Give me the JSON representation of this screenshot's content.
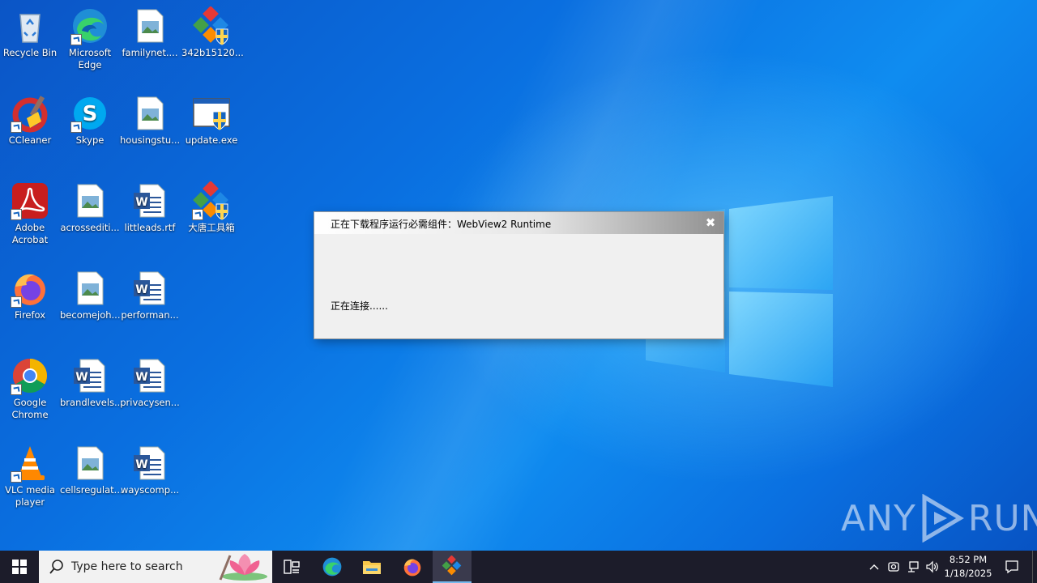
{
  "desktop": {
    "icons": [
      {
        "label": "Recycle Bin",
        "icon": "recycle-bin-icon"
      },
      {
        "label": "Microsoft Edge",
        "icon": "edge-icon"
      },
      {
        "label": "familynet....",
        "icon": "image-file-icon"
      },
      {
        "label": "342b15120...",
        "icon": "app-icon"
      },
      {
        "label": "CCleaner",
        "icon": "ccleaner-icon"
      },
      {
        "label": "Skype",
        "icon": "skype-icon"
      },
      {
        "label": "housingstu...",
        "icon": "image-file-icon"
      },
      {
        "label": "update.exe",
        "icon": "exe-icon"
      },
      {
        "label": "Adobe Acrobat",
        "icon": "acrobat-icon"
      },
      {
        "label": "acrossediti...",
        "icon": "image-file-icon"
      },
      {
        "label": "littleads.rtf",
        "icon": "word-file-icon"
      },
      {
        "label": "大唐工具箱",
        "icon": "app-icon"
      },
      {
        "label": "Firefox",
        "icon": "firefox-icon"
      },
      {
        "label": "becomejoh...",
        "icon": "image-file-icon"
      },
      {
        "label": "performan...",
        "icon": "word-file-icon"
      },
      {
        "label": "Google Chrome",
        "icon": "chrome-icon"
      },
      {
        "label": "brandlevels...",
        "icon": "word-file-icon"
      },
      {
        "label": "privacysen...",
        "icon": "word-file-icon"
      },
      {
        "label": "VLC media player",
        "icon": "vlc-icon"
      },
      {
        "label": "cellsregulat...",
        "icon": "image-file-icon"
      },
      {
        "label": "wayscomp...",
        "icon": "word-file-icon"
      }
    ]
  },
  "dialog": {
    "title": "正在下载程序运行必需组件：WebView2 Runtime",
    "close_label": "✖",
    "status": "正在连接......"
  },
  "watermark": {
    "left": "ANY",
    "right": "RUN"
  },
  "taskbar": {
    "search_placeholder": "Type here to search",
    "clock_time": "8:52 PM",
    "clock_date": "1/18/2025"
  },
  "colors": {
    "accent": "#0a6fe0",
    "taskbar": "#1c1c2a",
    "dialog_bg": "#f0f0f0"
  }
}
